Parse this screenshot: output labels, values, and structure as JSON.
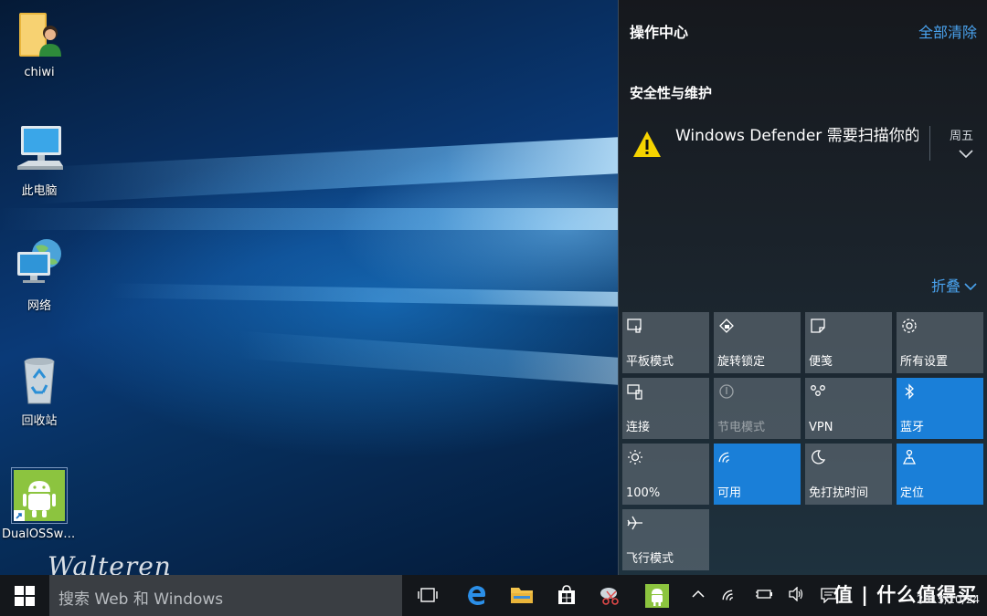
{
  "desktop": {
    "icons": [
      {
        "label": "chiwi",
        "icon": "user-folder-icon"
      },
      {
        "label": "此电脑",
        "icon": "computer-icon"
      },
      {
        "label": "网络",
        "icon": "network-icon"
      },
      {
        "label": "回收站",
        "icon": "recycle-bin-icon"
      },
      {
        "label": "DualOSSwi...",
        "icon": "android-shortcut-icon"
      }
    ],
    "watermark": "Walteren"
  },
  "action_center": {
    "title": "操作中心",
    "clear_all": "全部清除",
    "section_title": "安全性与维护",
    "notification": {
      "text": "Windows Defender 需要扫描你的计",
      "day": "周五",
      "icon": "warning-icon"
    },
    "collapse_label": "折叠",
    "tiles": [
      {
        "label": "平板模式",
        "icon": "tablet-mode-icon",
        "state": "off"
      },
      {
        "label": "旋转锁定",
        "icon": "rotation-lock-icon",
        "state": "off"
      },
      {
        "label": "便笺",
        "icon": "note-icon",
        "state": "off"
      },
      {
        "label": "所有设置",
        "icon": "settings-icon",
        "state": "off"
      },
      {
        "label": "连接",
        "icon": "connect-icon",
        "state": "off"
      },
      {
        "label": "节电模式",
        "icon": "battery-saver-icon",
        "state": "disabled"
      },
      {
        "label": "VPN",
        "icon": "vpn-icon",
        "state": "off"
      },
      {
        "label": "蓝牙",
        "icon": "bluetooth-icon",
        "state": "on"
      },
      {
        "label": "100%",
        "icon": "brightness-icon",
        "state": "off"
      },
      {
        "label": "可用",
        "icon": "wifi-icon",
        "state": "on"
      },
      {
        "label": "免打扰时间",
        "icon": "quiet-hours-icon",
        "state": "off"
      },
      {
        "label": "定位",
        "icon": "location-icon",
        "state": "on"
      },
      {
        "label": "飞行模式",
        "icon": "airplane-icon",
        "state": "off"
      }
    ],
    "colors": {
      "accent": "#1a7fd8",
      "link": "#4aa3ef",
      "tile_off": "#6e7882"
    }
  },
  "taskbar": {
    "search_placeholder": "搜索 Web 和 Windows",
    "apps": [
      "task-view-icon",
      "edge-icon",
      "file-explorer-icon",
      "store-icon",
      "snipping-icon",
      "android-icon"
    ],
    "tray_icons": [
      "chevron-up-icon",
      "wifi-icon",
      "battery-icon",
      "volume-icon",
      "action-center-icon"
    ],
    "date": "2015/10/24",
    "brand": "值 | 什么值得买"
  }
}
